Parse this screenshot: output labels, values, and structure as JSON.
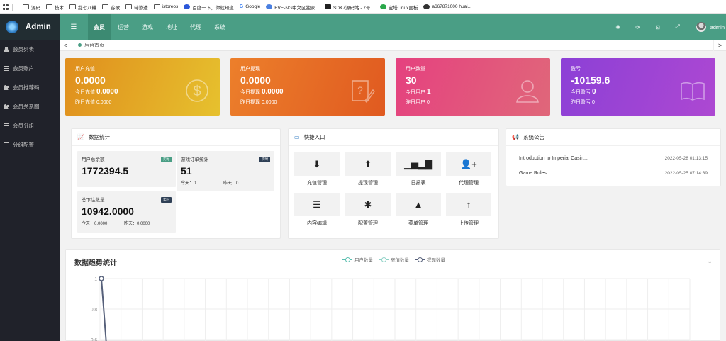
{
  "bookmarks": [
    "源码",
    "技术",
    "乱七八糟",
    "谷歌",
    "待渗透",
    "istoreos",
    "百度一下，你就知道",
    "Google",
    "EVE-NG中文区独家...",
    "SDK7源码站 - 7号...",
    "宝塔Linux面板",
    "a667871000  huai..."
  ],
  "app": {
    "title": "Admin"
  },
  "sidebar": {
    "items": [
      {
        "label": "会员列表"
      },
      {
        "label": "会员账户"
      },
      {
        "label": "会员推荐码"
      },
      {
        "label": "会员关系图"
      },
      {
        "label": "会员分组"
      },
      {
        "label": "分组配置"
      }
    ]
  },
  "topbar": {
    "menu_icon": "☰",
    "tabs": [
      "会员",
      "运营",
      "游戏",
      "地址",
      "代理",
      "系统"
    ],
    "active_tab": "会员",
    "user": "admin"
  },
  "pagetabs": {
    "prev": "<",
    "next": ">",
    "current": "后台首页"
  },
  "cards": [
    {
      "title": "用户充值",
      "value": "0.0000",
      "today_label": "今日充值",
      "today_value": "0.0000",
      "yday_label": "昨日充值",
      "yday_value": "0.0000"
    },
    {
      "title": "用户提现",
      "value": "0.0000",
      "today_label": "今日提现",
      "today_value": "0.0000",
      "yday_label": "昨日提现",
      "yday_value": "0.0000"
    },
    {
      "title": "用户数量",
      "value": "30",
      "today_label": "今日用户",
      "today_value": "1",
      "yday_label": "昨日用户",
      "yday_value": "0"
    },
    {
      "title": "盈亏",
      "value": "-10159.6",
      "today_label": "今日盈亏",
      "today_value": "0",
      "yday_label": "昨日盈亏",
      "yday_value": "0"
    }
  ],
  "stats_panel": {
    "title": "数据统计",
    "boxes": [
      {
        "title": "用户总余额",
        "badge": "实时",
        "value": "1772394.5"
      },
      {
        "title": "游戏订单统计",
        "badge": "实时",
        "value": "51",
        "today": "今天：0",
        "yday": "昨天：0"
      },
      {
        "title": "总下注数量",
        "badge": "实时",
        "value": "10942.0000",
        "today": "今天：0.0000",
        "yday": "昨天：0.0000"
      }
    ]
  },
  "quick_panel": {
    "title": "快捷入口",
    "items": [
      {
        "label": "充值管理",
        "icon": "download-icon"
      },
      {
        "label": "提现管理",
        "icon": "upload-icon"
      },
      {
        "label": "日报表",
        "icon": "bar-chart-icon"
      },
      {
        "label": "代理管理",
        "icon": "add-user-icon"
      },
      {
        "label": "内容编辑",
        "icon": "list-icon"
      },
      {
        "label": "配置管理",
        "icon": "asterisk-icon"
      },
      {
        "label": "菜单管理",
        "icon": "tree-icon"
      },
      {
        "label": "上传管理",
        "icon": "arrow-up-icon"
      }
    ]
  },
  "notice_panel": {
    "title": "系统公告",
    "items": [
      {
        "title": "Introduction to Imperial Casin...",
        "date": "2022-05-28 01:13:15"
      },
      {
        "title": "Game Rules",
        "date": "2022-05-25 07:14:39"
      }
    ]
  },
  "chart_data": {
    "type": "line",
    "title": "数据趋势统计",
    "series": [
      {
        "name": "用户数量",
        "color": "#5bbfb0"
      },
      {
        "name": "充值数量",
        "color": "#8ed1c6"
      },
      {
        "name": "提现数量",
        "color": "#56607a"
      }
    ],
    "y_ticks": [
      "1",
      "0.8",
      "0.6"
    ],
    "ylim": [
      0,
      1
    ],
    "visible_segment": {
      "series": "提现数量",
      "y_values": [
        1,
        0.6
      ]
    }
  },
  "colors": {
    "accent": "#4a9e85",
    "sidebar": "#20222a"
  }
}
